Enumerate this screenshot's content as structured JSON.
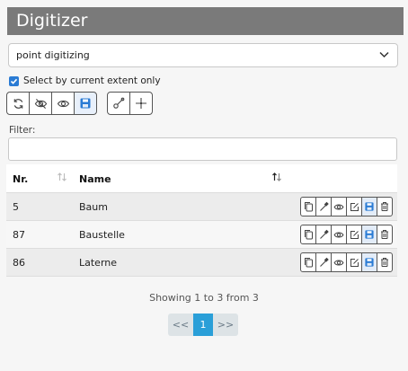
{
  "panel": {
    "title": "Digitizer"
  },
  "mode_select": {
    "value": "point digitizing"
  },
  "extent_checkbox": {
    "label": "Select by current extent only",
    "checked": true
  },
  "toolbar": {
    "group1": [
      "refresh-icon",
      "eye-slash-icon",
      "eye-icon",
      "save-icon"
    ],
    "group2": [
      "draw-point-icon",
      "crosshair-icon"
    ]
  },
  "filter": {
    "label": "Filter:",
    "value": ""
  },
  "table": {
    "columns": [
      "Nr.",
      "Name"
    ],
    "rows": [
      {
        "nr": "5",
        "name": "Baum"
      },
      {
        "nr": "87",
        "name": "Baustelle"
      },
      {
        "nr": "86",
        "name": "Laterne"
      }
    ],
    "row_actions": [
      "copy-icon",
      "pipette-icon",
      "eye-icon",
      "edit-icon",
      "save-icon",
      "trash-icon"
    ]
  },
  "pagination": {
    "summary": "Showing 1 to 3 from 3",
    "prev": "<<",
    "current": "1",
    "next": ">>"
  },
  "colors": {
    "title_bar": "#7a7a7a",
    "accent": "#2a7bd4",
    "page_active": "#2a9fd8"
  }
}
